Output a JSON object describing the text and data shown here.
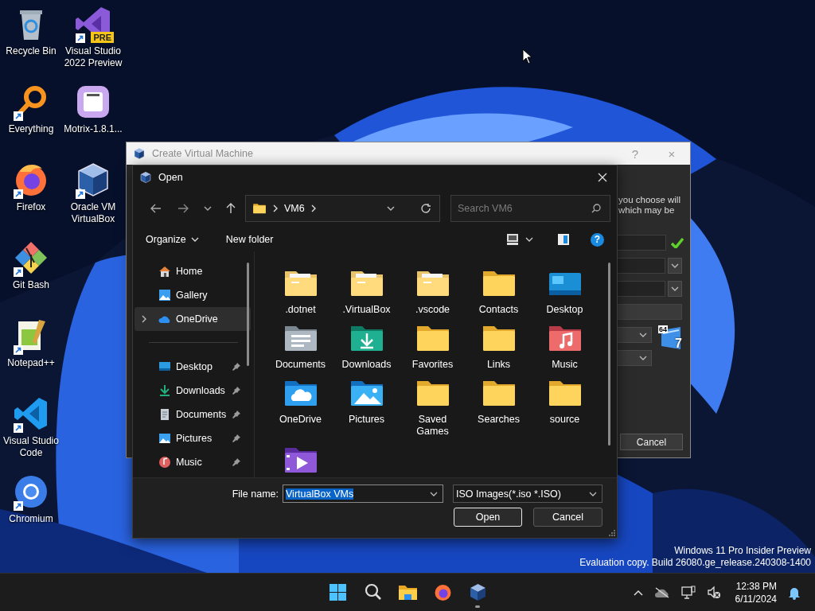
{
  "desktop": {
    "icons": [
      {
        "label": "Recycle Bin",
        "shortcut": false
      },
      {
        "label": "Everything",
        "shortcut": true
      },
      {
        "label": "Firefox",
        "shortcut": true
      },
      {
        "label": "Git Bash",
        "shortcut": true
      },
      {
        "label": "Notepad++",
        "shortcut": true
      },
      {
        "label": "Visual Studio Code",
        "shortcut": true
      },
      {
        "label": "Chromium",
        "shortcut": true
      },
      {
        "label": "Visual Studio 2022 Preview",
        "shortcut": true,
        "badge": "PRE"
      },
      {
        "label": "Motrix-1.8.1...",
        "shortcut": false
      },
      {
        "label": "Oracle VM VirtualBox",
        "shortcut": true
      }
    ]
  },
  "background_window": {
    "title": "Create Virtual Machine",
    "title_buttons": [
      "?",
      "×"
    ],
    "description_lines": [
      "you choose will",
      "which may be"
    ],
    "fields": [
      {
        "kind": "text",
        "valid": true
      },
      {
        "kind": "combo"
      },
      {
        "kind": "combo"
      },
      {
        "kind": "disabled"
      },
      {
        "kind": "dropdown",
        "os_badge": {
          "bits": "64",
          "version": "7"
        }
      },
      {
        "kind": "dropdown"
      }
    ],
    "cancel_button": "Cancel"
  },
  "open_dialog": {
    "title": "Open",
    "address": [
      "VM6"
    ],
    "search": {
      "placeholder": "Search VM6"
    },
    "toolbar": {
      "organize": "Organize",
      "new_folder": "New folder",
      "help": "?"
    },
    "nav_main": [
      {
        "label": "Home",
        "kind": "home",
        "selected": false,
        "expandable": false
      },
      {
        "label": "Gallery",
        "kind": "gallery",
        "selected": false,
        "expandable": false
      },
      {
        "label": "OneDrive",
        "kind": "onedrive",
        "selected": true,
        "expandable": true
      }
    ],
    "quick_access": [
      {
        "label": "Desktop",
        "kind": "desktop",
        "pinned": true
      },
      {
        "label": "Downloads",
        "kind": "downloads",
        "pinned": true
      },
      {
        "label": "Documents",
        "kind": "documents",
        "pinned": true
      },
      {
        "label": "Pictures",
        "kind": "pictures",
        "pinned": true
      },
      {
        "label": "Music",
        "kind": "music",
        "pinned": true
      }
    ],
    "items": [
      {
        "name": ".dotnet",
        "kind": "hidden"
      },
      {
        "name": ".VirtualBox",
        "kind": "hidden"
      },
      {
        "name": ".vscode",
        "kind": "hidden"
      },
      {
        "name": "Contacts",
        "kind": "folder"
      },
      {
        "name": "Desktop",
        "kind": "desktop"
      },
      {
        "name": "Documents",
        "kind": "documents"
      },
      {
        "name": "Downloads",
        "kind": "downloads"
      },
      {
        "name": "Favorites",
        "kind": "folder"
      },
      {
        "name": "Links",
        "kind": "folder"
      },
      {
        "name": "Music",
        "kind": "music"
      },
      {
        "name": "OneDrive",
        "kind": "onedrive"
      },
      {
        "name": "Pictures",
        "kind": "pictures"
      },
      {
        "name": "Saved Games",
        "kind": "folder"
      },
      {
        "name": "Searches",
        "kind": "folder"
      },
      {
        "name": "source",
        "kind": "folder"
      },
      {
        "kind": "videos"
      }
    ],
    "file_name": {
      "label": "File name:",
      "value": "VirtualBox VMs",
      "selected": true
    },
    "file_type": "ISO Images(*.iso *.ISO)",
    "buttons": [
      {
        "label": "Open",
        "default": true
      },
      {
        "label": "Cancel",
        "default": false
      }
    ]
  },
  "build_info": [
    "Windows 11 Pro Insider Preview",
    "Evaluation copy. Build 26080.ge_release.240308-1400"
  ],
  "taskbar": {
    "apps": [
      {
        "running": false
      },
      {
        "running": false
      },
      {
        "running": false
      },
      {
        "running": false
      },
      {
        "running": true
      }
    ],
    "clock": {
      "time": "12:38 PM",
      "date": "6/11/2024"
    }
  }
}
